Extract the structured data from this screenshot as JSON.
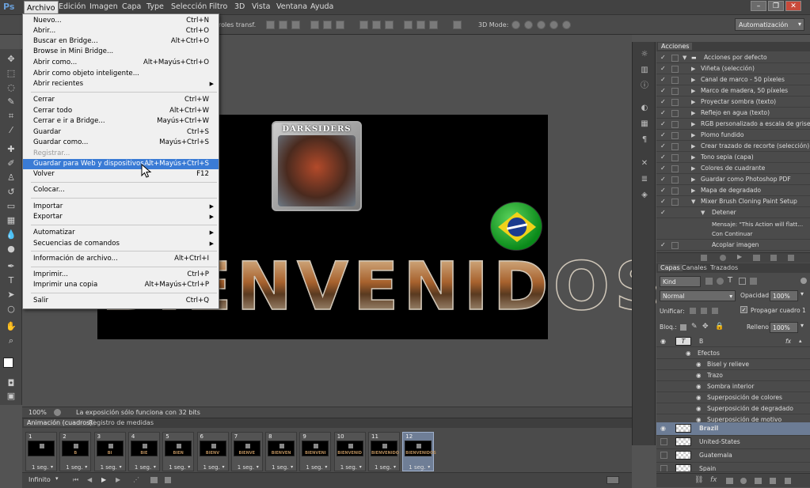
{
  "app": {
    "logo": "Ps"
  },
  "menubar": {
    "items": [
      "Archivo",
      "Edición",
      "Imagen",
      "Capa",
      "Type",
      "Selección",
      "Filtro",
      "3D",
      "Vista",
      "Ventana",
      "Ayuda"
    ],
    "min": "–",
    "restore": "❐",
    "close": "✕"
  },
  "optbar": {
    "transform_label": "roles transf.",
    "mode_label": "3D Mode:",
    "workspace": "Automatización"
  },
  "file_menu": {
    "items": [
      {
        "label": "Nuevo...",
        "shortcut": "Ctrl+N"
      },
      {
        "label": "Abrir...",
        "shortcut": "Ctrl+O"
      },
      {
        "label": "Buscar en Bridge...",
        "shortcut": "Alt+Ctrl+O"
      },
      {
        "label": "Browse in Mini Bridge...",
        "shortcut": ""
      },
      {
        "label": "Abrir como...",
        "shortcut": "Alt+Mayús+Ctrl+O"
      },
      {
        "label": "Abrir como objeto inteligente...",
        "shortcut": ""
      },
      {
        "label": "Abrir recientes",
        "shortcut": "",
        "submenu": true
      },
      {
        "label": "Cerrar",
        "shortcut": "Ctrl+W"
      },
      {
        "label": "Cerrar todo",
        "shortcut": "Alt+Ctrl+W"
      },
      {
        "label": "Cerrar e ir a Bridge...",
        "shortcut": "Mayús+Ctrl+W"
      },
      {
        "label": "Guardar",
        "shortcut": "Ctrl+S"
      },
      {
        "label": "Guardar como...",
        "shortcut": "Mayús+Ctrl+S"
      },
      {
        "label": "Registrar...",
        "shortcut": "",
        "disabled": true
      },
      {
        "label": "Guardar para Web y dispositivos...",
        "shortcut": "Alt+Mayús+Ctrl+S",
        "highlighted": true
      },
      {
        "label": "Volver",
        "shortcut": "F12"
      },
      {
        "label": "Colocar...",
        "shortcut": ""
      },
      {
        "label": "Importar",
        "shortcut": "",
        "submenu": true
      },
      {
        "label": "Exportar",
        "shortcut": "",
        "submenu": true
      },
      {
        "label": "Automatizar",
        "shortcut": "",
        "submenu": true
      },
      {
        "label": "Secuencias de comandos",
        "shortcut": "",
        "submenu": true
      },
      {
        "label": "Información de archivo...",
        "shortcut": "Alt+Ctrl+I"
      },
      {
        "label": "Imprimir...",
        "shortcut": "Ctrl+P"
      },
      {
        "label": "Imprimir una copia",
        "shortcut": "Alt+Mayús+Ctrl+P"
      },
      {
        "label": "Salir",
        "shortcut": "Ctrl+Q"
      }
    ]
  },
  "document": {
    "cover_title": "DARKSIDERS",
    "headline": "BIENVENIDOS"
  },
  "status": {
    "zoom": "100%",
    "message": "La exposición sólo funciona con 32 bits"
  },
  "actions_panel": {
    "tab": "Acciones",
    "set_name": "Acciones por defecto",
    "items": [
      "Viñeta (selección)",
      "Canal de marco - 50 píxeles",
      "Marco de madera, 50 píxeles",
      "Proyectar sombra (texto)",
      "Reflejo en agua (texto)",
      "RGB personalizado a escala de grises",
      "Plomo fundido",
      "Crear trazado de recorte (selección)",
      "Tono sepia (capa)",
      "Colores de cuadrante",
      "Guardar como Photoshop PDF",
      "Mapa de degradado",
      "Mixer Brush Cloning Paint Setup"
    ],
    "sub_action": "Detener",
    "message_line1": "Mensaje: \"This Action will flatt...",
    "message_line2": "Con Continuar",
    "last_item": "Acoplar imagen"
  },
  "layers_panel": {
    "tabs": [
      "Capas",
      "Canales",
      "Trazados"
    ],
    "kind": "Kind",
    "blend": "Normal",
    "opacity_label": "Opacidad:",
    "opacity": "100%",
    "unify_label": "Unificar:",
    "propagate_label": "Propagar cuadro 1",
    "lock_label": "Bloq.:",
    "fill_label": "Relleno:",
    "fill": "100%",
    "text_layer": "B",
    "fx": "fx",
    "effects_label": "Efectos",
    "effects": [
      "Bisel y relieve",
      "Trazo",
      "Sombra interior",
      "Superposición de colores",
      "Superposición de degradado",
      "Superposición de motivo"
    ],
    "layers": [
      "Brazil",
      "United-States",
      "Guatemala",
      "Spain"
    ]
  },
  "timeline": {
    "tabs": [
      "Animación (cuadros)",
      "Registro de medidas"
    ],
    "frames": [
      {
        "n": "1",
        "dur": "1 seg."
      },
      {
        "n": "2",
        "dur": "1 seg."
      },
      {
        "n": "3",
        "dur": "1 seg."
      },
      {
        "n": "4",
        "dur": "1 seg."
      },
      {
        "n": "5",
        "dur": "1 seg."
      },
      {
        "n": "6",
        "dur": "1 seg."
      },
      {
        "n": "7",
        "dur": "1 seg."
      },
      {
        "n": "8",
        "dur": "1 seg."
      },
      {
        "n": "9",
        "dur": "1 seg."
      },
      {
        "n": "10",
        "dur": "1 seg."
      },
      {
        "n": "11",
        "dur": "1 seg."
      },
      {
        "n": "12",
        "dur": "1 seg."
      }
    ],
    "frame_texts": [
      "",
      "B",
      "BI",
      "BIE",
      "BIEN",
      "BIENV",
      "BIENVE",
      "BIENVEN",
      "BIENVENI",
      "BIENVENID",
      "BIENVENIDO",
      "BIENVENIDOS"
    ],
    "selected_frame": 12,
    "loop": "Infinito"
  }
}
